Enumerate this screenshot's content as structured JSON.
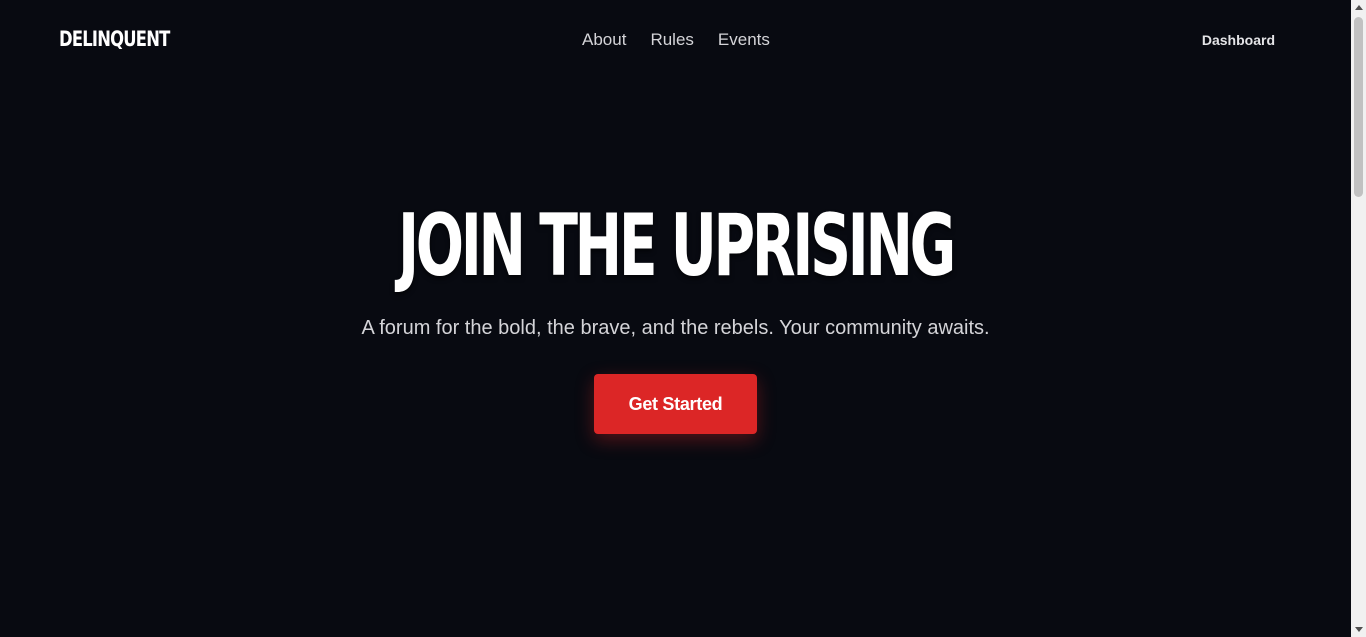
{
  "nav": {
    "logo": "DELINQUENT",
    "links": [
      "About",
      "Rules",
      "Events"
    ],
    "dashboard": "Dashboard"
  },
  "hero": {
    "title": "JOIN THE UPRISING",
    "subtitle": "A forum for the bold, the brave, and the rebels. Your community awaits.",
    "cta": "Get Started"
  },
  "colors": {
    "background": "#080a11",
    "accent": "#dc2626",
    "text": "#ffffff"
  },
  "icons": {
    "scroll_up": "chevron-up-icon",
    "scroll_down": "chevron-down-icon"
  }
}
